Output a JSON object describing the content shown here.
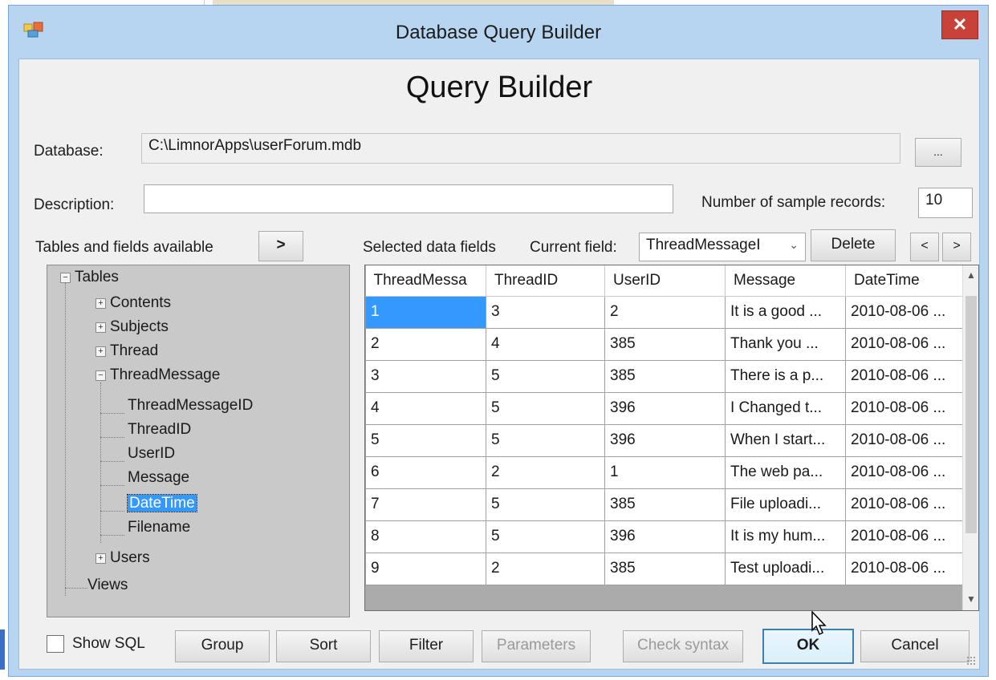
{
  "window": {
    "title": "Database Query Builder",
    "close_glyph": "✕"
  },
  "heading": "Query Builder",
  "database": {
    "label": "Database:",
    "value": "C:\\LimnorApps\\userForum.mdb",
    "browse_label": "..."
  },
  "description": {
    "label": "Description:",
    "value": ""
  },
  "sample": {
    "label": "Number of sample records:",
    "value": "10"
  },
  "tables_panel": {
    "label": "Tables and fields available",
    "add_label": ">"
  },
  "fields_bar": {
    "selected_label": "Selected data fields",
    "current_label": "Current field:",
    "current_value": "ThreadMessageI",
    "delete_label": "Delete",
    "prev_label": "<",
    "next_label": ">"
  },
  "tree": {
    "root": "Tables",
    "tables": [
      "Contents",
      "Subjects",
      "Thread",
      "ThreadMessage"
    ],
    "fields": [
      "ThreadMessageID",
      "ThreadID",
      "UserID",
      "Message",
      "DateTime",
      "Filename"
    ],
    "after": "Users",
    "views": "Views",
    "selected_field": "DateTime"
  },
  "grid": {
    "columns": [
      "ThreadMessa",
      "ThreadID",
      "UserID",
      "Message",
      "DateTime"
    ],
    "rows": [
      [
        "1",
        "3",
        "2",
        "It is a good ...",
        "2010-08-06 ..."
      ],
      [
        "2",
        "4",
        "385",
        "Thank you ...",
        "2010-08-06 ..."
      ],
      [
        "3",
        "5",
        "385",
        "There is a p...",
        "2010-08-06 ..."
      ],
      [
        "4",
        "5",
        "396",
        "I Changed t...",
        "2010-08-06 ..."
      ],
      [
        "5",
        "5",
        "396",
        "When I start...",
        "2010-08-06 ..."
      ],
      [
        "6",
        "2",
        "1",
        "The web pa...",
        "2010-08-06 ..."
      ],
      [
        "7",
        "5",
        "385",
        "File uploadi...",
        "2010-08-06 ..."
      ],
      [
        "8",
        "5",
        "396",
        "It is my hum...",
        "2010-08-06 ..."
      ],
      [
        "9",
        "2",
        "385",
        "Test uploadi...",
        "2010-08-06 ..."
      ]
    ]
  },
  "buttons": {
    "show_sql": "Show SQL",
    "group": "Group",
    "sort": "Sort",
    "filter": "Filter",
    "parameters": "Parameters",
    "check_syntax": "Check syntax",
    "ok": "OK",
    "cancel": "Cancel"
  }
}
